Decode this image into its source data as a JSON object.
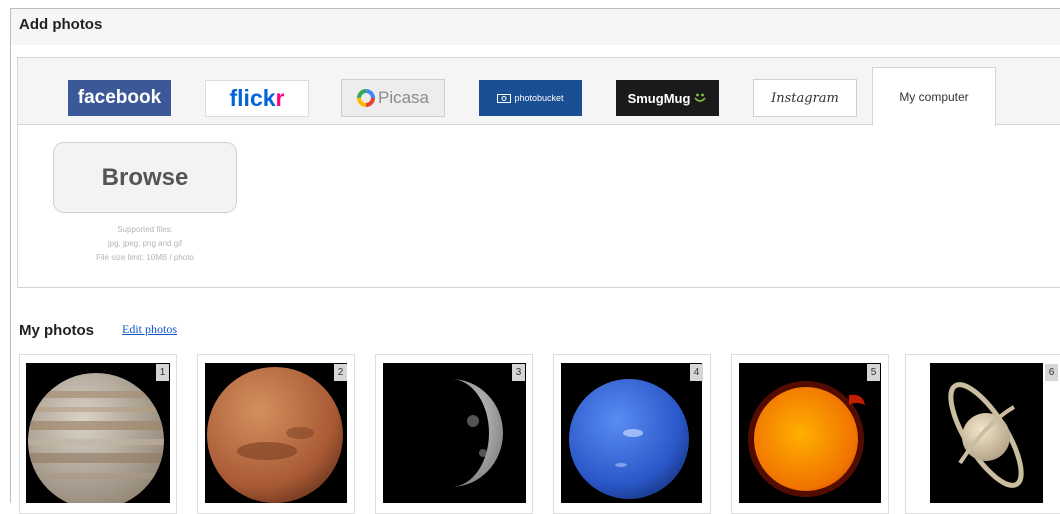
{
  "dialog": {
    "title": "Add photos"
  },
  "services": {
    "facebook": {
      "label": "facebook"
    },
    "flickr": {
      "label_a": "flick",
      "label_b": "r",
      "color_a": "#0063dc",
      "color_b": "#ff0084"
    },
    "picasa": {
      "label": "Picasa"
    },
    "photobucket": {
      "label": "photobucket"
    },
    "smugmug": {
      "label": "SmugMug"
    },
    "instagram": {
      "label": "Instagram"
    },
    "my_computer": {
      "label": "My computer"
    }
  },
  "upload": {
    "browse_label": "Browse",
    "note_line1": "Supported files:",
    "note_line2": "jpg, jpeg, png and gif",
    "note_line3": "File size limit: 10MB / photo"
  },
  "photos": {
    "heading": "My photos",
    "edit_link": "Edit photos",
    "items": [
      {
        "number": "1",
        "subject": "Jupiter"
      },
      {
        "number": "2",
        "subject": "Mars"
      },
      {
        "number": "3",
        "subject": "Moon"
      },
      {
        "number": "4",
        "subject": "Neptune"
      },
      {
        "number": "5",
        "subject": "Sun"
      },
      {
        "number": "6",
        "subject": "Saturn"
      }
    ]
  },
  "colors": {
    "facebook": "#3b5998",
    "photobucket": "#1a4f94",
    "smugmug": "#1a1a1a",
    "link": "#1155cc"
  }
}
